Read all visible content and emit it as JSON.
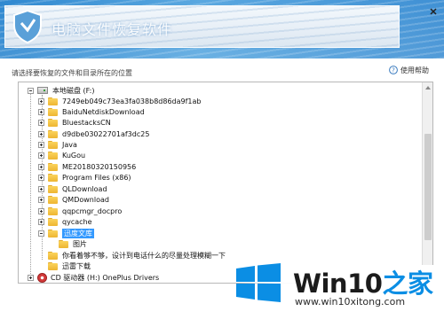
{
  "header": {
    "title": "电脑文件恢复软件",
    "close_glyph": "✕"
  },
  "instruction": "请选择要恢复的文件和目录所在的位置",
  "help": {
    "label": "使用帮助",
    "icon": "help-icon"
  },
  "tree": {
    "drive_f": "本地磁盘 (F:)",
    "folders": [
      "7249eb049c73ea3fa038b8d86da9f1ab",
      "BaiduNetdiskDownload",
      "BluestacksCN",
      "d9dbe03022701af3dc25",
      "Java",
      "KuGou",
      "ME20180320150956",
      "Program Files (x86)",
      "QLDownload",
      "QMDownload",
      "qqpcmgr_docpro",
      "qycache"
    ],
    "selected_folder": "迅度文库",
    "child_folder": "图片",
    "extra_folders": [
      "你看着够不够，设计到电话什么的尽量处理模糊一下",
      "迅雷下载"
    ],
    "drive_h": "CD 驱动器 (H:) OnePlus Drivers"
  },
  "watermark": {
    "brand_main": "Win10",
    "brand_accent": "之家",
    "url": "www.win10xitong.com",
    "logo_color": "#0b8ee4"
  }
}
